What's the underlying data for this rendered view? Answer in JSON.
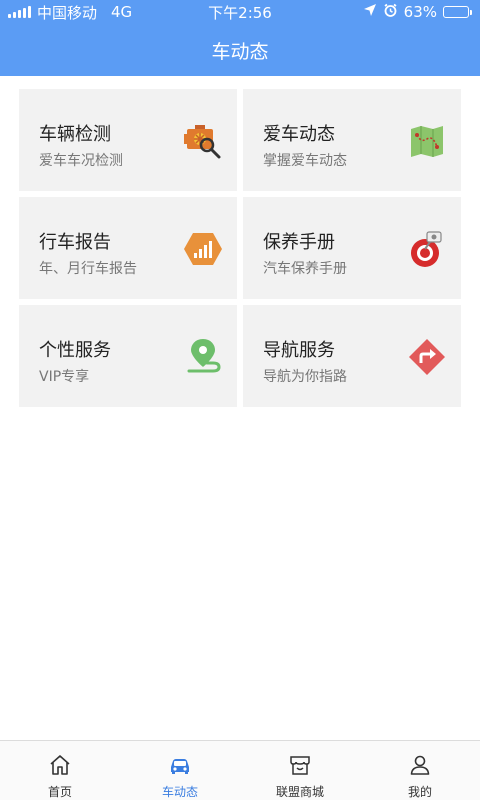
{
  "status_bar": {
    "carrier": "中国移动",
    "network": "4G",
    "time": "下午2:56",
    "battery_percent": "63%",
    "battery_level": 0.63,
    "icons": [
      "signal-icon",
      "location-arrow-icon",
      "alarm-icon",
      "battery-icon"
    ]
  },
  "header": {
    "title": "车动态"
  },
  "cards": [
    {
      "title": "车辆检测",
      "subtitle": "爱车车况检测",
      "icon": "engine-inspection-icon"
    },
    {
      "title": "爱车动态",
      "subtitle": "掌握爱车动态",
      "icon": "map-route-icon"
    },
    {
      "title": "行车报告",
      "subtitle": "年、月行车报告",
      "icon": "report-chart-icon"
    },
    {
      "title": "保养手册",
      "subtitle": "汽车保养手册",
      "icon": "maintenance-tools-icon"
    },
    {
      "title": "个性服务",
      "subtitle": "VIP专享",
      "icon": "location-pin-icon"
    },
    {
      "title": "导航服务",
      "subtitle": "导航为你指路",
      "icon": "turn-sign-icon"
    }
  ],
  "tabs": [
    {
      "label": "首页",
      "icon": "home-icon",
      "active": false
    },
    {
      "label": "车动态",
      "icon": "car-icon",
      "active": true
    },
    {
      "label": "联盟商城",
      "icon": "store-icon",
      "active": false
    },
    {
      "label": "我的",
      "icon": "user-icon",
      "active": false
    }
  ],
  "colors": {
    "header_blue": "#5b9cf4",
    "active_tab": "#3a7de0",
    "card_bg": "#f2f2f2"
  }
}
